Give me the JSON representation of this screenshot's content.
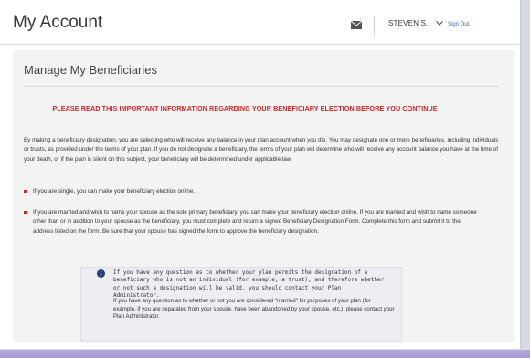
{
  "header": {
    "title": "My Account",
    "user_label": "STEVEN S.",
    "sign_out": "Sign Out"
  },
  "page": {
    "title": "Manage My Beneficiaries",
    "warning": "PLEASE READ THIS IMPORTANT INFORMATION REGARDING YOUR BENEFICIARY ELECTION BEFORE YOU CONTINUE",
    "intro": "By making a beneficiary designation, you are selecting who will receive any balance in your plan account when you die. You may designate one or more beneficiaries, including individuals or trusts, as provided under the terms of your plan. If you do not designate a beneficiary, the terms of your plan will determine who will receive any account balance you have at the time of your death, or if the plan is silent on this subject, your beneficiary will be determined under applicable law.",
    "bullets": [
      "If you are single, you can make your beneficiary election online.",
      "If you are married and wish to name your spouse as the sole primary beneficiary, you can make your beneficiary election online. If you are married and wish to name someone other than or in addition to your spouse as the beneficiary, you must complete and return a signed Beneficiary Designation Form. Complete this form and submit it to the address listed on the form. Be sure that your spouse has signed the form to approve the beneficiary designation."
    ],
    "info_1": "If you have any question as to whether your plan permits the designation of a beneficiary who is not an individual (for example, a trust), and therefore whether or not such a designation will be valid, you should contact your Plan Administrator.",
    "info_2": "If you have any question as to whether or not you are considered \"married\" for purposes of your plan (for example, if you are separated from your spouse, have been abandoned by your spouse, etc.), please contact your Plan Administrator."
  },
  "colors": {
    "warning": "#d02525",
    "link": "#2c6fb5",
    "info_icon": "#1f3f78",
    "bottom_bar": "#a898d6"
  },
  "icons": {
    "mail": "mail-icon",
    "user_menu": "chevron-down-icon",
    "info": "info-icon"
  }
}
